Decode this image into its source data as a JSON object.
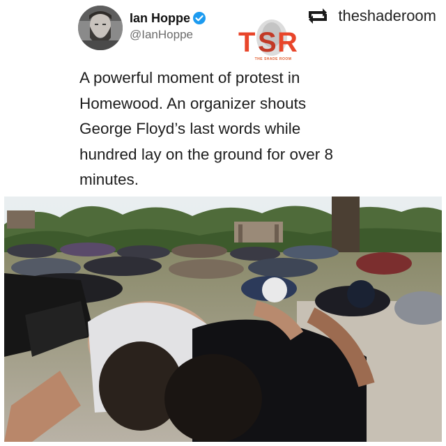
{
  "repost": {
    "username": "theshaderoom",
    "icon": "repost-icon"
  },
  "tweet": {
    "author_name": "Ian Hoppe",
    "author_handle": "@IanHoppe",
    "verified_icon": "verified-badge-icon",
    "text_lines": [
      "A powerful moment of protest in",
      "Homewood. An organizer shouts",
      "George Floyd’s last words while",
      "hundred lay on the ground for over 8",
      "minutes."
    ]
  },
  "logo": {
    "letters": "TSR",
    "subtitle": "THE SHADE ROOM",
    "brand_color": "#e8452a"
  },
  "colors": {
    "verified": "#1d9bf0",
    "logo_red": "#e8452a"
  }
}
